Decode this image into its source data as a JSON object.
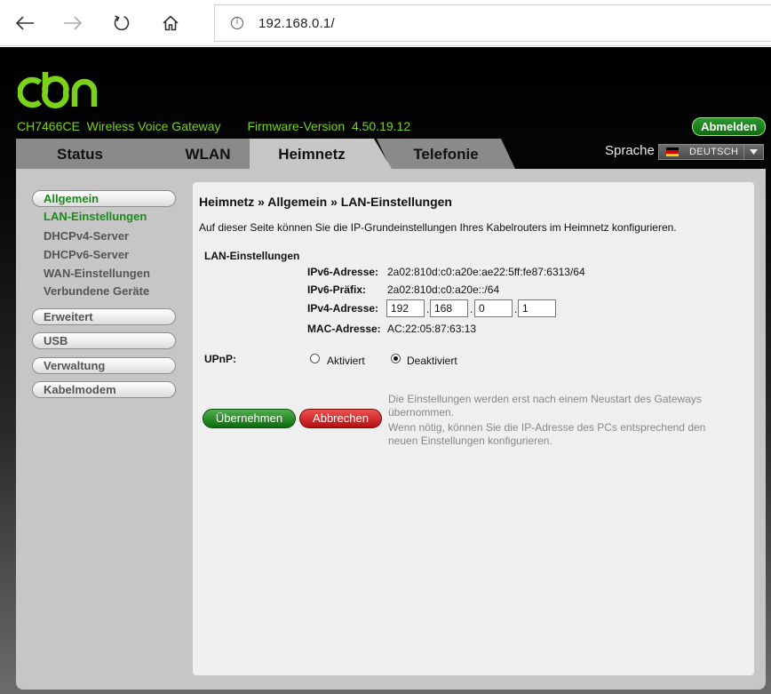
{
  "browser": {
    "url": "192.168.0.1/",
    "url_info_glyph": "i"
  },
  "header": {
    "brand": "cbn",
    "model": "CH7466CE",
    "product": "Wireless Voice Gateway",
    "firmware_label": "Firmware-Version",
    "firmware_version": "4.50.19.12",
    "logout_label": "Abmelden",
    "brand_color": "#7ad21a"
  },
  "tabs": [
    {
      "label": "Status",
      "active": false
    },
    {
      "label": "WLAN",
      "active": false
    },
    {
      "label": "Heimnetz",
      "active": true
    },
    {
      "label": "Telefonie",
      "active": false
    }
  ],
  "language": {
    "label": "Sprache",
    "selected": "DEUTSCH"
  },
  "sidebar": {
    "groups": [
      {
        "label": "Allgemein",
        "active": true,
        "items": [
          {
            "label": "LAN-Einstellungen",
            "active": true
          },
          {
            "label": "DHCPv4-Server",
            "active": false
          },
          {
            "label": "DHCPv6-Server",
            "active": false
          },
          {
            "label": "WAN-Einstellungen",
            "active": false
          },
          {
            "label": "Verbundene Geräte",
            "active": false
          }
        ]
      },
      {
        "label": "Erweitert",
        "active": false
      },
      {
        "label": "USB",
        "active": false
      },
      {
        "label": "Verwaltung",
        "active": false
      },
      {
        "label": "Kabelmodem",
        "active": false
      }
    ]
  },
  "content": {
    "breadcrumb": "Heimnetz » Allgemein » LAN-Einstellungen",
    "intro": "Auf dieser Seite können Sie die IP-Grundeinstellungen Ihres Kabelrouters im Heimnetz konfigurieren.",
    "section_title": "LAN-Einstellungen",
    "ipv6_address_label": "IPv6-Adresse:",
    "ipv6_address": "2a02:810d:c0:a20e:ae22:5ff:fe87:6313/64",
    "ipv6_prefix_label": "IPv6-Präfix:",
    "ipv6_prefix": "2a02:810d:c0:a20e::/64",
    "ipv4_address_label": "IPv4-Adresse:",
    "ipv4_octets": [
      "192",
      "168",
      "0",
      "1"
    ],
    "ipv4_separator": ".",
    "mac_address_label": "MAC-Adresse:",
    "mac_address": "AC:22:05:87:63:13",
    "upnp_label": "UPnP:",
    "upnp_options": [
      {
        "label": "Aktiviert",
        "checked": false
      },
      {
        "label": "Deaktiviert",
        "checked": true
      }
    ],
    "notes": [
      "Die Einstellungen werden erst nach einem Neustart des Gateways",
      "übernommen.",
      "Wenn nötig, können Sie die IP-Adresse des PCs entsprechend den",
      "neuen Einstellungen konfigurieren."
    ],
    "apply_label": "Übernehmen",
    "cancel_label": "Abbrechen"
  }
}
